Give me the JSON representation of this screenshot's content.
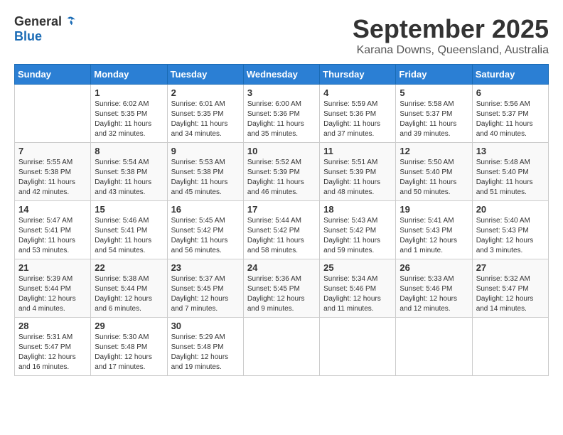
{
  "header": {
    "logo_general": "General",
    "logo_blue": "Blue",
    "month": "September 2025",
    "location": "Karana Downs, Queensland, Australia"
  },
  "days_of_week": [
    "Sunday",
    "Monday",
    "Tuesday",
    "Wednesday",
    "Thursday",
    "Friday",
    "Saturday"
  ],
  "weeks": [
    [
      {
        "day": "",
        "info": ""
      },
      {
        "day": "1",
        "info": "Sunrise: 6:02 AM\nSunset: 5:35 PM\nDaylight: 11 hours\nand 32 minutes."
      },
      {
        "day": "2",
        "info": "Sunrise: 6:01 AM\nSunset: 5:35 PM\nDaylight: 11 hours\nand 34 minutes."
      },
      {
        "day": "3",
        "info": "Sunrise: 6:00 AM\nSunset: 5:36 PM\nDaylight: 11 hours\nand 35 minutes."
      },
      {
        "day": "4",
        "info": "Sunrise: 5:59 AM\nSunset: 5:36 PM\nDaylight: 11 hours\nand 37 minutes."
      },
      {
        "day": "5",
        "info": "Sunrise: 5:58 AM\nSunset: 5:37 PM\nDaylight: 11 hours\nand 39 minutes."
      },
      {
        "day": "6",
        "info": "Sunrise: 5:56 AM\nSunset: 5:37 PM\nDaylight: 11 hours\nand 40 minutes."
      }
    ],
    [
      {
        "day": "7",
        "info": "Sunrise: 5:55 AM\nSunset: 5:38 PM\nDaylight: 11 hours\nand 42 minutes."
      },
      {
        "day": "8",
        "info": "Sunrise: 5:54 AM\nSunset: 5:38 PM\nDaylight: 11 hours\nand 43 minutes."
      },
      {
        "day": "9",
        "info": "Sunrise: 5:53 AM\nSunset: 5:38 PM\nDaylight: 11 hours\nand 45 minutes."
      },
      {
        "day": "10",
        "info": "Sunrise: 5:52 AM\nSunset: 5:39 PM\nDaylight: 11 hours\nand 46 minutes."
      },
      {
        "day": "11",
        "info": "Sunrise: 5:51 AM\nSunset: 5:39 PM\nDaylight: 11 hours\nand 48 minutes."
      },
      {
        "day": "12",
        "info": "Sunrise: 5:50 AM\nSunset: 5:40 PM\nDaylight: 11 hours\nand 50 minutes."
      },
      {
        "day": "13",
        "info": "Sunrise: 5:48 AM\nSunset: 5:40 PM\nDaylight: 11 hours\nand 51 minutes."
      }
    ],
    [
      {
        "day": "14",
        "info": "Sunrise: 5:47 AM\nSunset: 5:41 PM\nDaylight: 11 hours\nand 53 minutes."
      },
      {
        "day": "15",
        "info": "Sunrise: 5:46 AM\nSunset: 5:41 PM\nDaylight: 11 hours\nand 54 minutes."
      },
      {
        "day": "16",
        "info": "Sunrise: 5:45 AM\nSunset: 5:42 PM\nDaylight: 11 hours\nand 56 minutes."
      },
      {
        "day": "17",
        "info": "Sunrise: 5:44 AM\nSunset: 5:42 PM\nDaylight: 11 hours\nand 58 minutes."
      },
      {
        "day": "18",
        "info": "Sunrise: 5:43 AM\nSunset: 5:42 PM\nDaylight: 11 hours\nand 59 minutes."
      },
      {
        "day": "19",
        "info": "Sunrise: 5:41 AM\nSunset: 5:43 PM\nDaylight: 12 hours\nand 1 minute."
      },
      {
        "day": "20",
        "info": "Sunrise: 5:40 AM\nSunset: 5:43 PM\nDaylight: 12 hours\nand 3 minutes."
      }
    ],
    [
      {
        "day": "21",
        "info": "Sunrise: 5:39 AM\nSunset: 5:44 PM\nDaylight: 12 hours\nand 4 minutes."
      },
      {
        "day": "22",
        "info": "Sunrise: 5:38 AM\nSunset: 5:44 PM\nDaylight: 12 hours\nand 6 minutes."
      },
      {
        "day": "23",
        "info": "Sunrise: 5:37 AM\nSunset: 5:45 PM\nDaylight: 12 hours\nand 7 minutes."
      },
      {
        "day": "24",
        "info": "Sunrise: 5:36 AM\nSunset: 5:45 PM\nDaylight: 12 hours\nand 9 minutes."
      },
      {
        "day": "25",
        "info": "Sunrise: 5:34 AM\nSunset: 5:46 PM\nDaylight: 12 hours\nand 11 minutes."
      },
      {
        "day": "26",
        "info": "Sunrise: 5:33 AM\nSunset: 5:46 PM\nDaylight: 12 hours\nand 12 minutes."
      },
      {
        "day": "27",
        "info": "Sunrise: 5:32 AM\nSunset: 5:47 PM\nDaylight: 12 hours\nand 14 minutes."
      }
    ],
    [
      {
        "day": "28",
        "info": "Sunrise: 5:31 AM\nSunset: 5:47 PM\nDaylight: 12 hours\nand 16 minutes."
      },
      {
        "day": "29",
        "info": "Sunrise: 5:30 AM\nSunset: 5:48 PM\nDaylight: 12 hours\nand 17 minutes."
      },
      {
        "day": "30",
        "info": "Sunrise: 5:29 AM\nSunset: 5:48 PM\nDaylight: 12 hours\nand 19 minutes."
      },
      {
        "day": "",
        "info": ""
      },
      {
        "day": "",
        "info": ""
      },
      {
        "day": "",
        "info": ""
      },
      {
        "day": "",
        "info": ""
      }
    ]
  ]
}
